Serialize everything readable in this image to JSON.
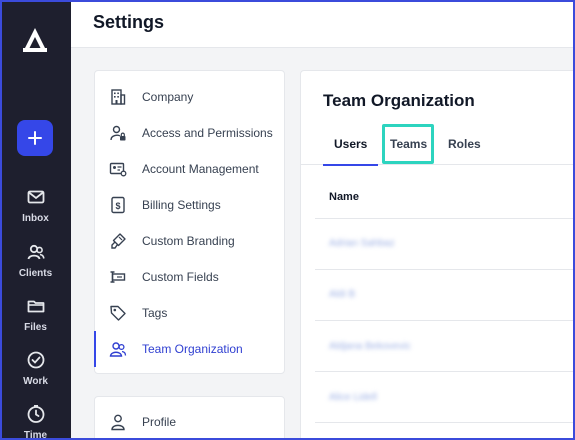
{
  "header": {
    "title": "Settings"
  },
  "rail": {
    "accent": "#3547e8",
    "new_button_icon": "plus-icon",
    "items": [
      {
        "label": "Inbox",
        "icon": "mail-icon"
      },
      {
        "label": "Clients",
        "icon": "users-icon"
      },
      {
        "label": "Files",
        "icon": "folder-icon"
      },
      {
        "label": "Work",
        "icon": "check-circle-icon"
      },
      {
        "label": "Time",
        "icon": "clock-icon"
      }
    ]
  },
  "settings_nav": {
    "items": [
      {
        "label": "Company",
        "icon": "building-icon"
      },
      {
        "label": "Access and Permissions",
        "icon": "user-lock-icon"
      },
      {
        "label": "Account Management",
        "icon": "id-card-icon"
      },
      {
        "label": "Billing Settings",
        "icon": "dollar-icon"
      },
      {
        "label": "Custom Branding",
        "icon": "brush-icon"
      },
      {
        "label": "Custom Fields",
        "icon": "field-icon"
      },
      {
        "label": "Tags",
        "icon": "tag-icon"
      },
      {
        "label": "Team Organization",
        "icon": "team-icon",
        "active": true
      }
    ],
    "profile": {
      "label": "Profile",
      "icon": "user-icon"
    }
  },
  "content": {
    "title": "Team Organization",
    "tabs": [
      {
        "label": "Users",
        "active": true
      },
      {
        "label": "Teams",
        "highlighted": true
      },
      {
        "label": "Roles"
      }
    ],
    "column_header": "Name",
    "rows": [
      {
        "name": "Adrian Sahbaz"
      },
      {
        "name": "Aldi B"
      },
      {
        "name": "Aldjana Bekovevic"
      },
      {
        "name": "Alice Lidell"
      }
    ]
  }
}
